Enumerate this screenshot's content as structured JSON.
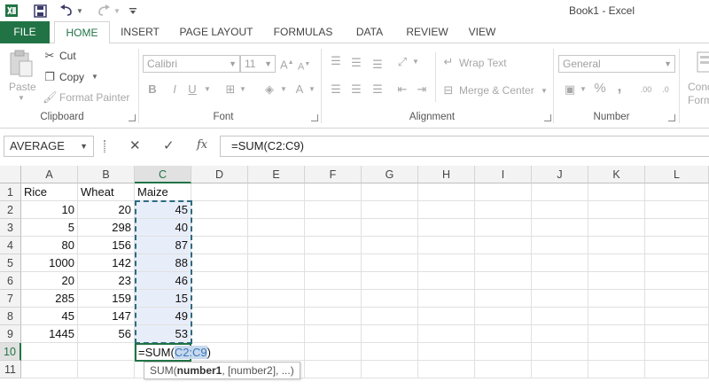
{
  "app": {
    "title": "Book1 - Excel"
  },
  "colors": {
    "accent": "#217346",
    "selection": "#e8eef9",
    "marquee": "#2d6b83",
    "ref_highlight": "#3a78b8"
  },
  "quick_access": {
    "icons": [
      "excel-logo-icon",
      "save-icon",
      "undo-icon",
      "redo-icon",
      "customize-icon"
    ]
  },
  "tabs": [
    {
      "label": "FILE"
    },
    {
      "label": "HOME"
    },
    {
      "label": "INSERT"
    },
    {
      "label": "PAGE LAYOUT"
    },
    {
      "label": "FORMULAS"
    },
    {
      "label": "DATA"
    },
    {
      "label": "REVIEW"
    },
    {
      "label": "VIEW"
    }
  ],
  "ribbon": {
    "clipboard": {
      "label": "Clipboard",
      "paste": "Paste",
      "cut": "Cut",
      "copy": "Copy",
      "format_painter": "Format Painter"
    },
    "font": {
      "label": "Font",
      "family": "Calibri",
      "size": "11",
      "bold": "B",
      "italic": "I",
      "underline": "U",
      "font_color": "A"
    },
    "alignment": {
      "label": "Alignment",
      "wrap_text": "Wrap Text",
      "merge_center": "Merge & Center"
    },
    "number": {
      "label": "Number",
      "format": "General",
      "percent": "%",
      "comma": ","
    },
    "styles": {
      "conditional": "Conc",
      "format_as": "Form"
    }
  },
  "formula_bar": {
    "name_box": "AVERAGE",
    "cancel": "✕",
    "enter": "✓",
    "fx": "fx",
    "formula": "=SUM(C2:C9)"
  },
  "grid": {
    "columns": [
      "A",
      "B",
      "C",
      "D",
      "E",
      "F",
      "G",
      "H",
      "I",
      "J",
      "K",
      "L"
    ],
    "rows": [
      "1",
      "2",
      "3",
      "4",
      "5",
      "6",
      "7",
      "8",
      "9",
      "10",
      "11"
    ],
    "headers": [
      "Rice",
      "Wheat",
      "Maize"
    ],
    "data": [
      [
        "10",
        "20",
        "45"
      ],
      [
        "5",
        "298",
        "40"
      ],
      [
        "80",
        "156",
        "87"
      ],
      [
        "1000",
        "142",
        "88"
      ],
      [
        "20",
        "23",
        "46"
      ],
      [
        "285",
        "159",
        "15"
      ],
      [
        "45",
        "147",
        "49"
      ],
      [
        "1445",
        "56",
        "53"
      ]
    ],
    "edit": {
      "prefix": "=SUM(",
      "ref": "C2:C9",
      "suffix": ")"
    },
    "tooltip": {
      "fn": "SUM(",
      "arg1": "number1",
      "rest": ", [number2], ...)"
    }
  }
}
